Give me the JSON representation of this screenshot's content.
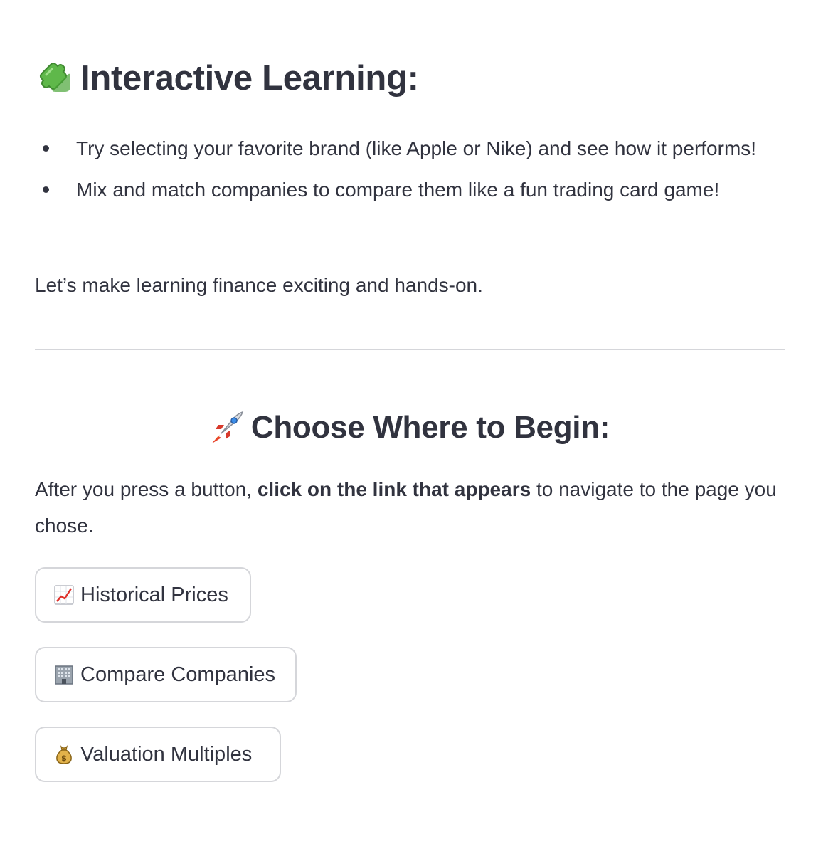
{
  "interactive_section": {
    "title": "Interactive Learning:",
    "title_icon": "puzzle-piece-icon",
    "tips": [
      "Try selecting your favorite brand (like Apple or Nike) and see how it performs!",
      "Mix and match companies to compare them like a fun trading card game!"
    ],
    "closing": "Let’s make learning finance exciting and hands-on."
  },
  "begin_section": {
    "title": "Choose Where to Begin:",
    "title_icon": "rocket-icon",
    "instruction_before": "After you press a button, ",
    "instruction_bold": "click on the link that appears",
    "instruction_after": " to navigate to the page you chose."
  },
  "buttons": [
    {
      "label": "Historical Prices",
      "icon": "chart-increasing-icon"
    },
    {
      "label": "Compare Companies",
      "icon": "office-building-icon"
    },
    {
      "label": "Valuation Multiples",
      "icon": "money-bag-icon"
    }
  ],
  "colors": {
    "text": "#31333f",
    "border": "#d5d6da",
    "background": "#ffffff"
  }
}
